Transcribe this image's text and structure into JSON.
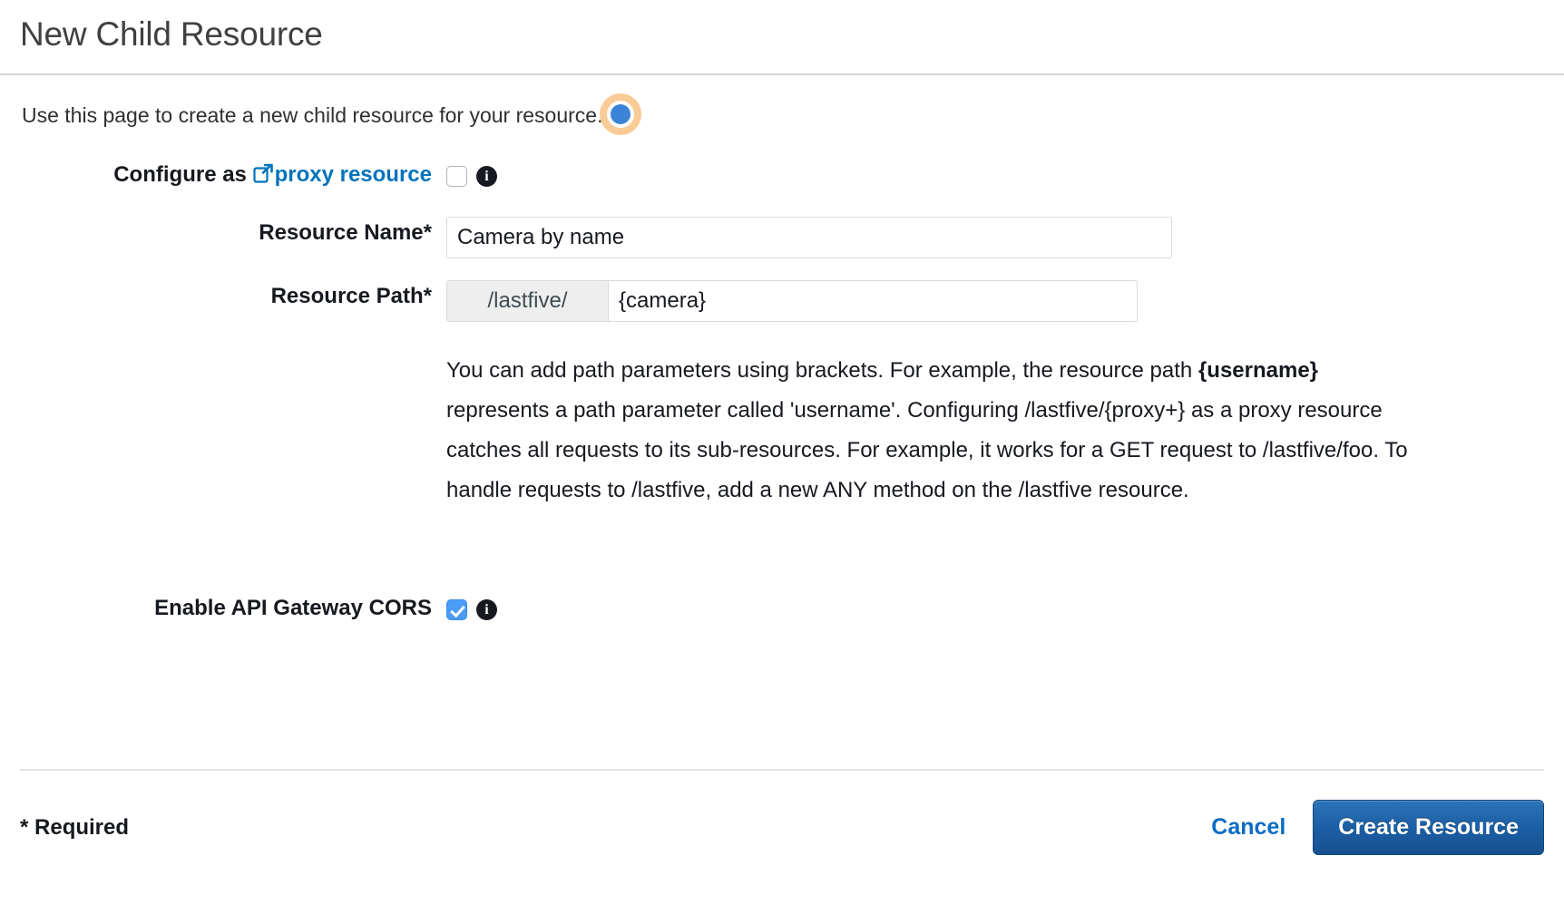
{
  "header": {
    "title": "New Child Resource"
  },
  "intro": {
    "text": "Use this page to create a new child resource for your resource.",
    "cursor_indicator": "click-indicator",
    "indicator_colors": {
      "dot": "#3b83d8",
      "halo": "#f9cb96"
    }
  },
  "form": {
    "proxy_row": {
      "label_prefix": "Configure as ",
      "link_label": "proxy resource",
      "link_icon": "external-link-icon",
      "checkbox_checked": false,
      "info_icon": "info-icon"
    },
    "resource_name": {
      "label": "Resource Name*",
      "value": "Camera by name",
      "placeholder": ""
    },
    "resource_path": {
      "label": "Resource Path*",
      "prefix": "/lastfive/",
      "value": "{camera}",
      "placeholder": ""
    },
    "help_text": {
      "part1": "You can add path parameters using brackets. For example, the resource path ",
      "bold": "{username}",
      "part2": " represents a path parameter called 'username'. Configuring /lastfive/{proxy+} as a proxy resource catches all requests to its sub-resources. For example, it works for a GET request to /lastfive/foo. To handle requests to /lastfive, add a new ANY method on the /lastfive resource."
    },
    "cors_row": {
      "label": "Enable API Gateway CORS",
      "checkbox_checked": true,
      "info_icon": "info-icon"
    }
  },
  "footer": {
    "required_note": "* Required",
    "cancel_label": "Cancel",
    "create_label": "Create Resource",
    "primary_color": "#1b5fa5",
    "link_color": "#0a6cc4"
  }
}
